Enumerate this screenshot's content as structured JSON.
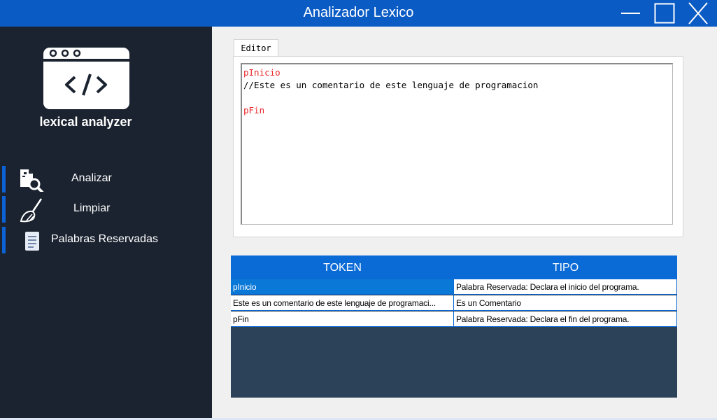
{
  "window": {
    "title": "Analizador Lexico",
    "colors": {
      "titlebar": "#0a5bc4",
      "sidebar": "#1b2330",
      "accent": "#0a6ad6",
      "keyword": "#e8262a"
    }
  },
  "sidebar": {
    "app_name": "lexical analyzer",
    "logo_icon": "code-window-icon",
    "items": [
      {
        "label": "Analizar",
        "icon": "document-search-icon"
      },
      {
        "label": "Limpiar",
        "icon": "broom-icon"
      },
      {
        "label": "Palabras Reservadas",
        "icon": "document-list-icon"
      }
    ]
  },
  "editor": {
    "tab_label": "Editor",
    "lines": [
      {
        "text": "pInicio",
        "type": "keyword"
      },
      {
        "text": "//Este es un comentario de este lenguaje de programacion",
        "type": "comment"
      },
      {
        "text": "",
        "type": "blank"
      },
      {
        "text": "pFin",
        "type": "keyword"
      }
    ]
  },
  "table": {
    "columns": [
      "TOKEN",
      "TIPO"
    ],
    "rows": [
      {
        "token": "pInicio",
        "tipo": "Palabra Reservada: Declara el inicio del programa.",
        "selected": true
      },
      {
        "token": "Este es un comentario de este lenguaje de programaci...",
        "tipo": "Es un Comentario",
        "selected": false
      },
      {
        "token": "pFin",
        "tipo": "Palabra Reservada: Declara el fin del programa.",
        "selected": false
      }
    ]
  }
}
